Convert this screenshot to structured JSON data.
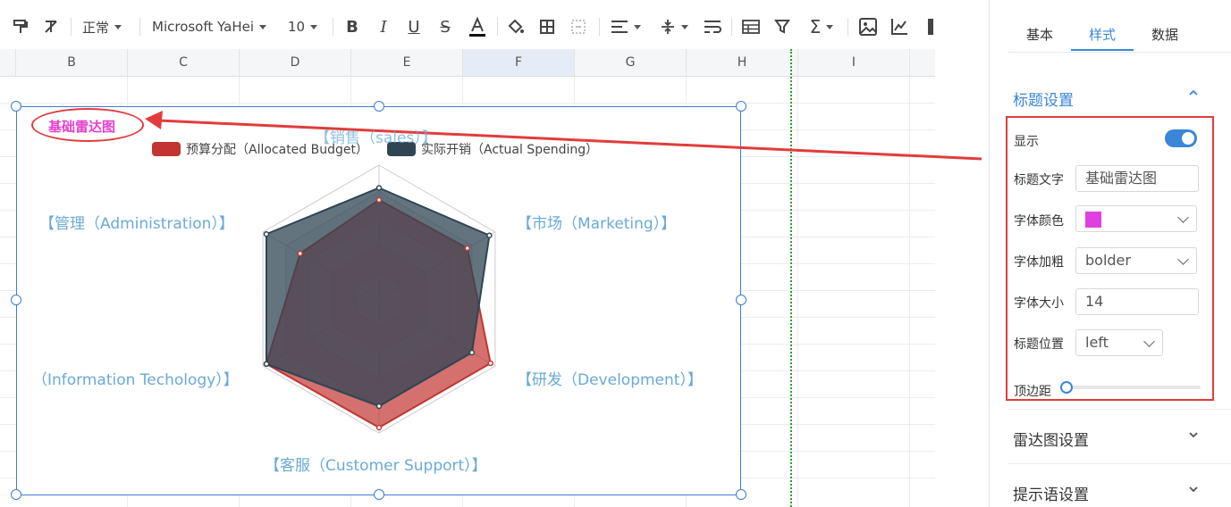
{
  "toolbar": {
    "style_select": "正常",
    "font_select": "Microsoft YaHei",
    "size_select": "10"
  },
  "columns": [
    "B",
    "C",
    "D",
    "E",
    "F",
    "G",
    "H",
    "I"
  ],
  "chart": {
    "title": "基础雷达图",
    "title_color": "#e63fd0",
    "legend": [
      {
        "name": "预算分配（Allocated Budget）",
        "color": "#c23531"
      },
      {
        "name": "实际开销（Actual Spending）",
        "color": "#2f4554"
      }
    ],
    "axis_labels": {
      "sales": "【销售（sales）】",
      "marketing": "【市场（Marketing）】",
      "development": "【研发（Development）】",
      "support": "【客服（Customer Support）】",
      "it": "（Information Techology）】",
      "it_prefix": "【",
      "admin": "【管理（Administration）】"
    }
  },
  "chart_data": {
    "type": "radar",
    "title": "基础雷达图",
    "indicators": [
      "销售（sales）",
      "市场（Marketing）",
      "研发（Development）",
      "客服（Customer Support）",
      "信息技术（Information Techology）",
      "管理（Administration）"
    ],
    "max": 1,
    "series": [
      {
        "name": "预算分配（Allocated Budget）",
        "values": [
          0.74,
          0.76,
          0.96,
          0.96,
          0.97,
          0.68
        ]
      },
      {
        "name": "实际开销（Actual Spending）",
        "values": [
          0.83,
          0.95,
          0.8,
          0.8,
          0.97,
          0.97
        ]
      }
    ]
  },
  "panel": {
    "tabs": [
      "基本",
      "样式",
      "数据"
    ],
    "active_tab": "样式",
    "section_title": "标题设置",
    "show_label": "显示",
    "title_text_label": "标题文字",
    "title_text_value": "基础雷达图",
    "font_color_label": "字体颜色",
    "font_color_value": "#e040e0",
    "font_weight_label": "字体加粗",
    "font_weight_value": "bolder",
    "font_size_label": "字体大小",
    "font_size_value": "14",
    "title_pos_label": "标题位置",
    "title_pos_value": "left",
    "top_margin_label": "顶边距",
    "radar_section": "雷达图设置",
    "tooltip_section": "提示语设置"
  }
}
